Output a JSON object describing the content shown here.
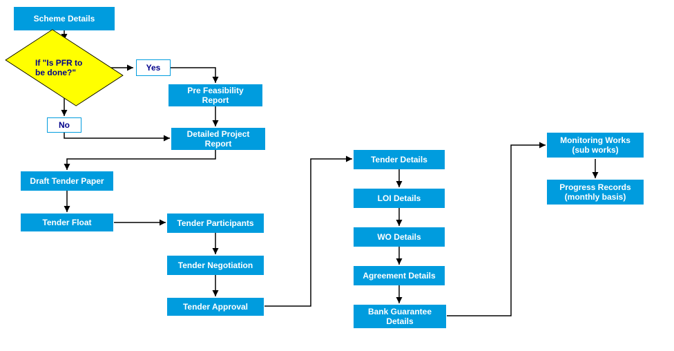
{
  "nodes": {
    "scheme_details": "Scheme Details",
    "decision": "If \"Is PFR to be done?\"",
    "yes": "Yes",
    "no": "No",
    "pre_feasibility": "Pre Feasibility Report",
    "detailed_project": "Detailed Project Report",
    "draft_tender": "Draft Tender Paper",
    "tender_float": "Tender Float",
    "tender_participants": "Tender Participants",
    "tender_negotiation": "Tender Negotiation",
    "tender_approval": "Tender Approval",
    "tender_details": "Tender Details",
    "loi_details": "LOI Details",
    "wo_details": "WO Details",
    "agreement_details": "Agreement Details",
    "bank_guarantee": "Bank Guarantee Details",
    "monitoring_works": "Monitoring Works (sub works)",
    "progress_records": "Progress Records (monthly basis)"
  }
}
